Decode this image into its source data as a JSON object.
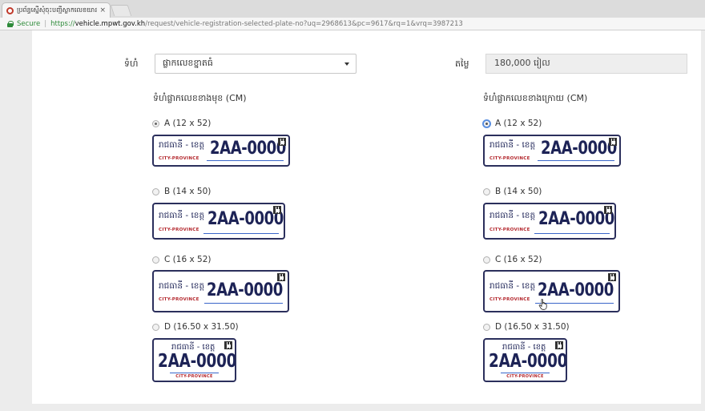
{
  "browser": {
    "tab_title": "ប្រព័ន្ធស្នើសុំចុះបញ្ជីស្លាកលេខយានយន្ត",
    "tab_close": "×",
    "secure_label": "Secure",
    "url_scheme": "https://",
    "url_host": "vehicle.mpwt.gov.kh",
    "url_path": "/request/vehicle-registration-selected-plate-no?uq=2968613&pc=9617&rq=1&vrq=3987213"
  },
  "form": {
    "size_label": "ទំហំ",
    "size_value": "ផ្លាកលេខខ្នាតធំ",
    "price_label": "តម្លៃ",
    "price_value": "180,000 រៀល"
  },
  "front": {
    "title": "ទំហំផ្លាកលេខខាងមុខ (CM)",
    "options": [
      {
        "label": "A (12 x 52)",
        "selected": true
      },
      {
        "label": "B (14 x 50)",
        "selected": false
      },
      {
        "label": "C (16 x 52)",
        "selected": false
      },
      {
        "label": "D (16.50 x 31.50)",
        "selected": false
      }
    ]
  },
  "rear": {
    "title": "ទំហំផ្លាកលេខខាងក្រោយ (CM)",
    "options": [
      {
        "label": "A (12 x 52)",
        "selected": true
      },
      {
        "label": "B (14 x 50)",
        "selected": false
      },
      {
        "label": "C (16 x 52)",
        "selected": false
      },
      {
        "label": "D (16.50 x 31.50)",
        "selected": false
      }
    ]
  },
  "plate": {
    "province_km": "រាជធានី - ខេត្ត",
    "province_en": "CITY-PROVINCE",
    "number": "2AA-0000"
  },
  "colors": {
    "plate_text": "#1d2356",
    "plate_red": "#b3262c",
    "plate_line": "#3a66c9",
    "secure_green": "#2e8b3a"
  },
  "icons": {
    "favicon": "ministry-logo-icon",
    "lock": "lock-icon",
    "dropdown": "caret-down-icon",
    "qr": "qr-code-icon",
    "cursor": "hand-pointer-icon"
  }
}
